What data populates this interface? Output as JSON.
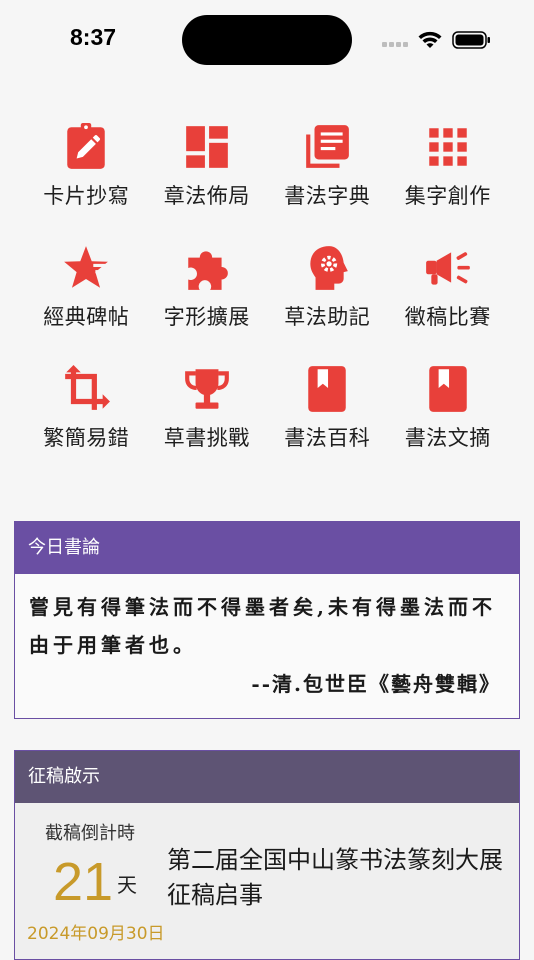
{
  "status_bar": {
    "time": "8:37"
  },
  "colors": {
    "icon_red": "#e8403a",
    "quote_header": "#6a4fa3",
    "contest_header": "#5e5474",
    "countdown_gold": "#c89a2a"
  },
  "grid": [
    {
      "label": "卡片抄寫",
      "icon": "card-edit-icon"
    },
    {
      "label": "章法佈局",
      "icon": "layout-icon"
    },
    {
      "label": "書法字典",
      "icon": "library-icon"
    },
    {
      "label": "集字創作",
      "icon": "grid-dots-icon"
    },
    {
      "label": "經典碑帖",
      "icon": "star-icon"
    },
    {
      "label": "字形擴展",
      "icon": "puzzle-icon"
    },
    {
      "label": "草法助記",
      "icon": "brain-gear-icon"
    },
    {
      "label": "徵稿比賽",
      "icon": "megaphone-icon"
    },
    {
      "label": "繁簡易錯",
      "icon": "crop-icon"
    },
    {
      "label": "草書挑戰",
      "icon": "trophy-icon"
    },
    {
      "label": "書法百科",
      "icon": "bookmark-icon"
    },
    {
      "label": "書法文摘",
      "icon": "bookmark-icon"
    }
  ],
  "quote": {
    "header": "今日書論",
    "text": "嘗見有得筆法而不得墨者矣,未有得墨法而不由于用筆者也。",
    "source": "--清.包世臣《藝舟雙輯》"
  },
  "contest": {
    "header": "征稿啟示",
    "countdown_label": "截稿倒計時",
    "days": "21",
    "unit": "天",
    "deadline": "2024年09月30日",
    "title": "第二届全国中山篆书法篆刻大展征稿启事"
  }
}
